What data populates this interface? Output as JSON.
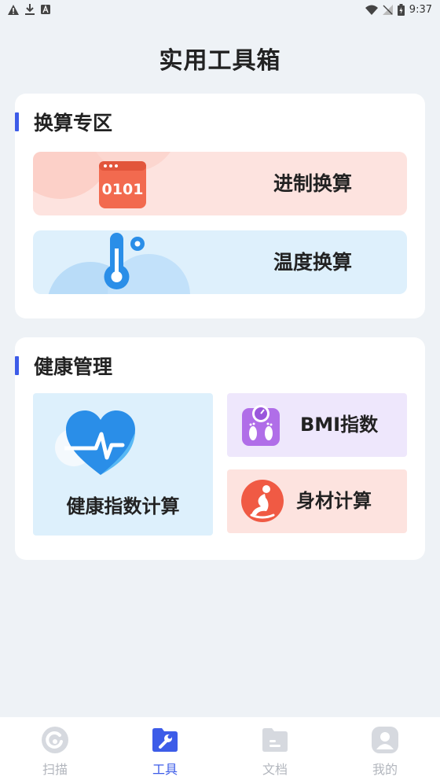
{
  "status_bar": {
    "time": "9:37",
    "left_icons": [
      "warning-icon",
      "download-icon",
      "font-icon"
    ],
    "right_icons": [
      "wifi-icon",
      "no-signal-icon",
      "battery-charging-icon"
    ]
  },
  "page": {
    "title": "实用工具箱"
  },
  "sections": {
    "convert": {
      "title": "换算专区",
      "items": [
        {
          "label": "进制换算",
          "icon": "binary-0101-icon",
          "icon_text": "0101",
          "color": "#f26a4f"
        },
        {
          "label": "温度换算",
          "icon": "thermometer-icon",
          "color": "#2a8ee8"
        }
      ]
    },
    "health": {
      "title": "健康管理",
      "items": [
        {
          "label": "健康指数计算",
          "icon": "heart-pulse-icon",
          "color": "#2a8ee8"
        },
        {
          "label": "BMI指数",
          "icon": "scale-icon",
          "color": "#b06ee8"
        },
        {
          "label": "身材计算",
          "icon": "body-figure-icon",
          "color": "#f05a44"
        }
      ]
    }
  },
  "bottom_nav": {
    "active": "tools",
    "items": [
      {
        "key": "scan",
        "label": "扫描",
        "icon": "scan-icon"
      },
      {
        "key": "tools",
        "label": "工具",
        "icon": "wrench-icon"
      },
      {
        "key": "docs",
        "label": "文档",
        "icon": "folder-icon"
      },
      {
        "key": "mine",
        "label": "我的",
        "icon": "user-icon"
      }
    ]
  },
  "colors": {
    "accent": "#3d5ce8",
    "background": "#eef2f6",
    "inactive_nav": "#b2b6bd"
  }
}
